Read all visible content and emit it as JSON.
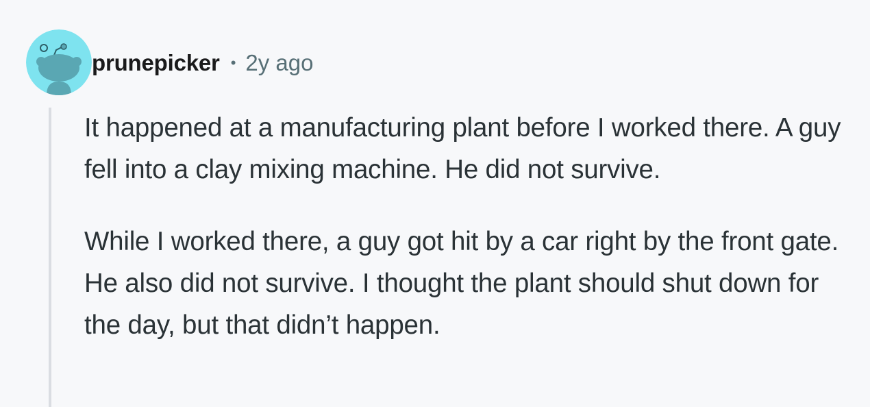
{
  "comment": {
    "author": {
      "username": "prunepicker",
      "avatar_icon": "snoo-avatar-icon",
      "avatar_color": "#7ee3ef"
    },
    "separator": "•",
    "timestamp": "2y ago",
    "paragraphs": [
      "It happened at a manufacturing plant before I worked there. A guy fell into a clay mixing machine. He did not survive.",
      "While I worked there, a guy got hit by a car right by the front gate. He also did not survive. I thought the plant should shut down for the day, but that didn’t happen."
    ]
  }
}
